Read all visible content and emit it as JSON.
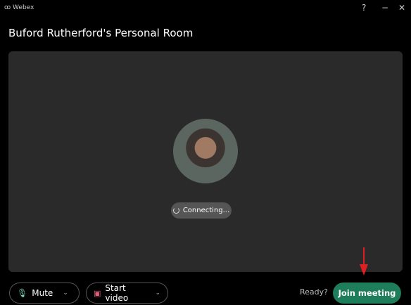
{
  "app": {
    "title": "Webex"
  },
  "window": {
    "help": "?",
    "minimize": "−",
    "close": "✕"
  },
  "room": {
    "title": "Buford Rutherford's Personal Room"
  },
  "status": {
    "connecting": "Connecting..."
  },
  "controls": {
    "mute": "Mute",
    "start_video": "Start video",
    "ready": "Ready?",
    "join": "Join meeting"
  },
  "colors": {
    "join": "#1e7d5a",
    "arrow": "#e02020"
  }
}
